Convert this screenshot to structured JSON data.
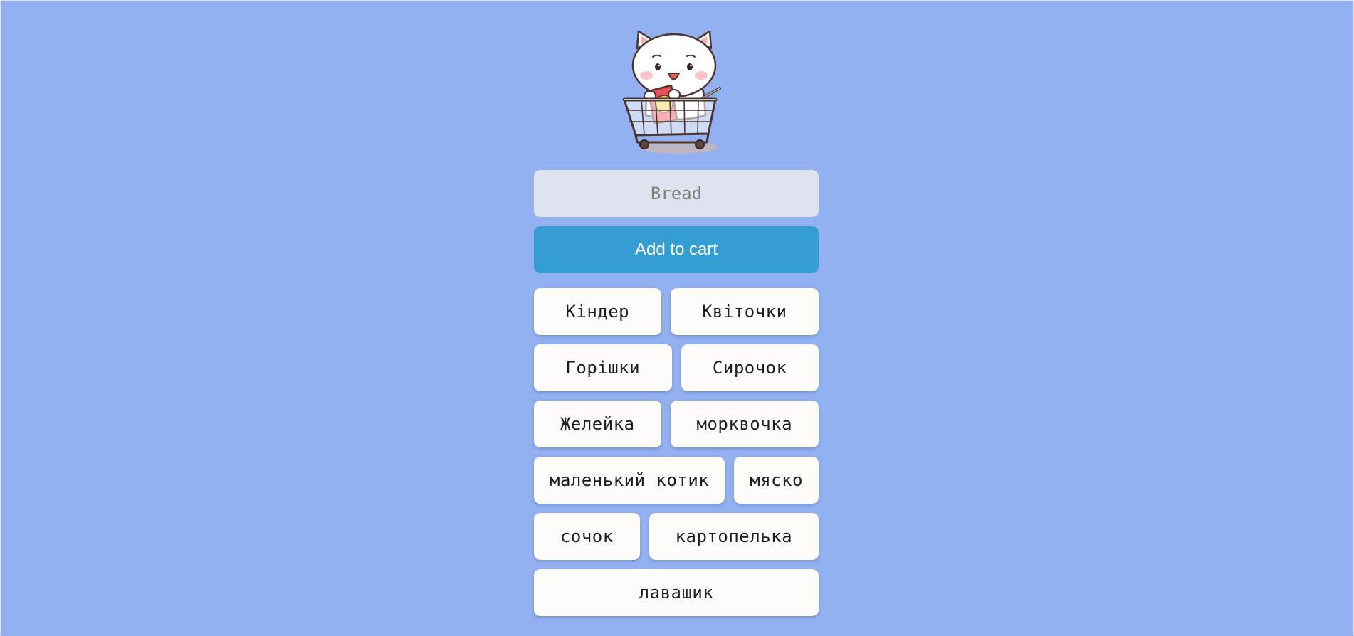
{
  "input": {
    "placeholder": "Bread",
    "value": ""
  },
  "add_button": {
    "label": "Add to cart"
  },
  "items": [
    "Кіндер",
    "Квіточки",
    "Горішки",
    "Сирочок",
    "Желейка",
    "морквочка",
    "маленький котик",
    "мяско",
    "сочок",
    "картопелька",
    "лавашик"
  ],
  "colors": {
    "background": "#93b1f0",
    "button_accent": "#349ed2",
    "input_background": "#dfe3ef",
    "item_background": "#fdfcf8"
  }
}
